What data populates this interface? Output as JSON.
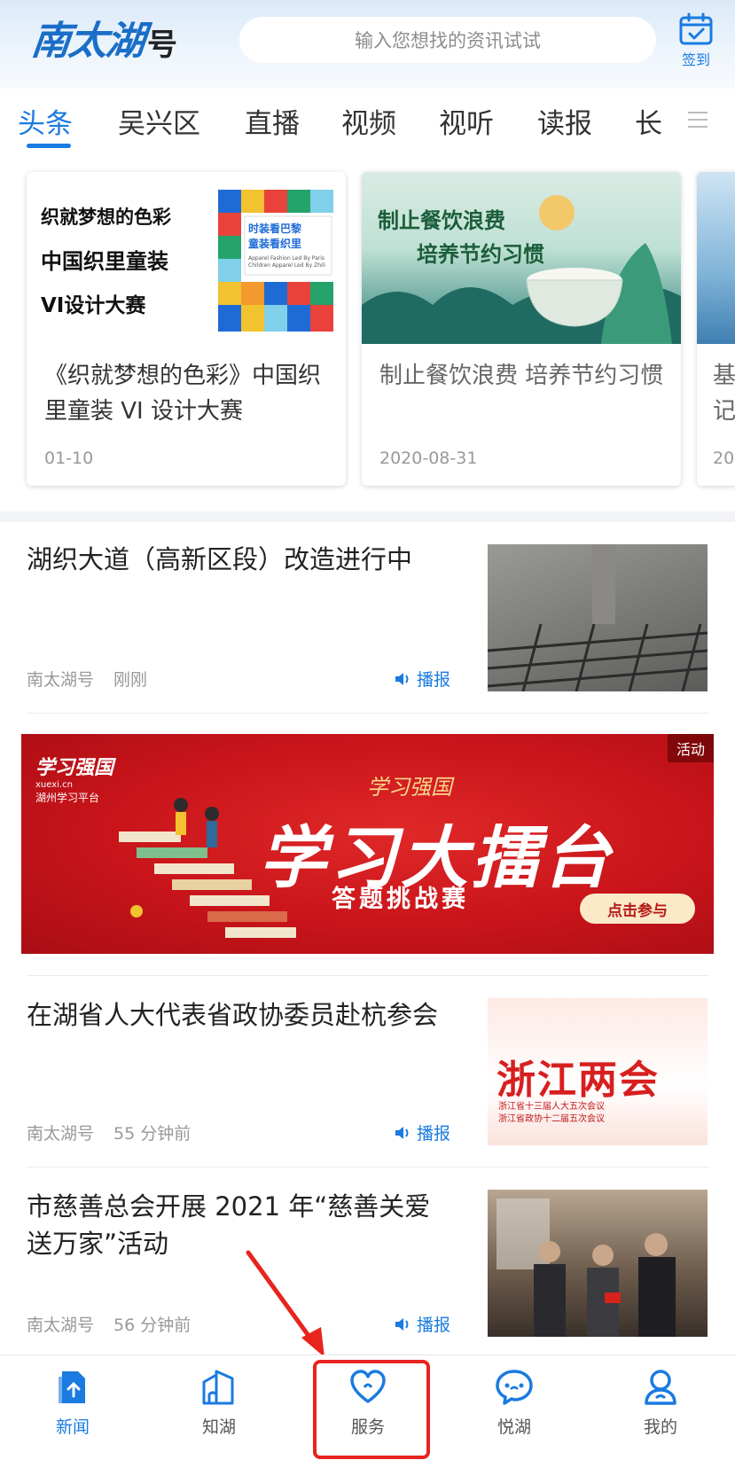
{
  "header": {
    "logo_main": "南太湖",
    "logo_sub": "号",
    "search_placeholder": "输入您想找的资讯试试",
    "signin_label": "签到"
  },
  "tabs": [
    "头条",
    "吴兴区",
    "直播",
    "视频",
    "视听",
    "读报",
    "长"
  ],
  "cards": [
    {
      "img_lines": [
        "织就梦想的色彩",
        "中国织里童装",
        "VI设计大赛"
      ],
      "img_tag_lines": [
        "时装看巴黎",
        "童装看织里"
      ],
      "img_tag_en": [
        "Apparel Fashion Led By Paris",
        "Children Apparel Led By Zhili"
      ],
      "title": "《织就梦想的色彩》中国织里童装 VI 设计大赛",
      "date": "01-10"
    },
    {
      "img_lines": [
        "制止餐饮浪费",
        "培养节约习惯"
      ],
      "title": "制止餐饮浪费 培养节约习惯",
      "date": "2020-08-31"
    },
    {
      "title": "基记",
      "date": "20"
    }
  ],
  "news": [
    {
      "title": "湖织大道（高新区段）改造进行中",
      "source": "南太湖号",
      "time": "刚刚",
      "play_label": "播报"
    },
    {
      "title": "在湖省人大代表省政协委员赴杭参会",
      "source": "南太湖号",
      "time": "55 分钟前",
      "play_label": "播报",
      "thumb_text": "浙江两会",
      "thumb_sub": [
        "浙江省十三届人大五次会议",
        "浙江省政协十二届五次会议"
      ]
    },
    {
      "title": "市慈善总会开展 2021 年“慈善关爱送万家”活动",
      "source": "南太湖号",
      "time": "56 分钟前",
      "play_label": "播报"
    }
  ],
  "banner": {
    "badge": "活动",
    "logo_text": "学习强国",
    "logo_url": "xuexi.cn",
    "platform": "湖州学习平台",
    "subtitle": "学习强国",
    "title": "学习大擂台",
    "tagline": "答题挑战赛",
    "cta": "点击参与"
  },
  "bottom_nav": [
    {
      "label": "新闻",
      "icon": "news-icon",
      "active": true
    },
    {
      "label": "知湖",
      "icon": "city-icon",
      "active": false
    },
    {
      "label": "服务",
      "icon": "heart-icon",
      "active": false
    },
    {
      "label": "悦湖",
      "icon": "chat-icon",
      "active": false
    },
    {
      "label": "我的",
      "icon": "profile-icon",
      "active": false
    }
  ],
  "colors": {
    "accent": "#1a7be0",
    "banner_red": "#c8141a",
    "highlight_red": "#e8241f"
  }
}
